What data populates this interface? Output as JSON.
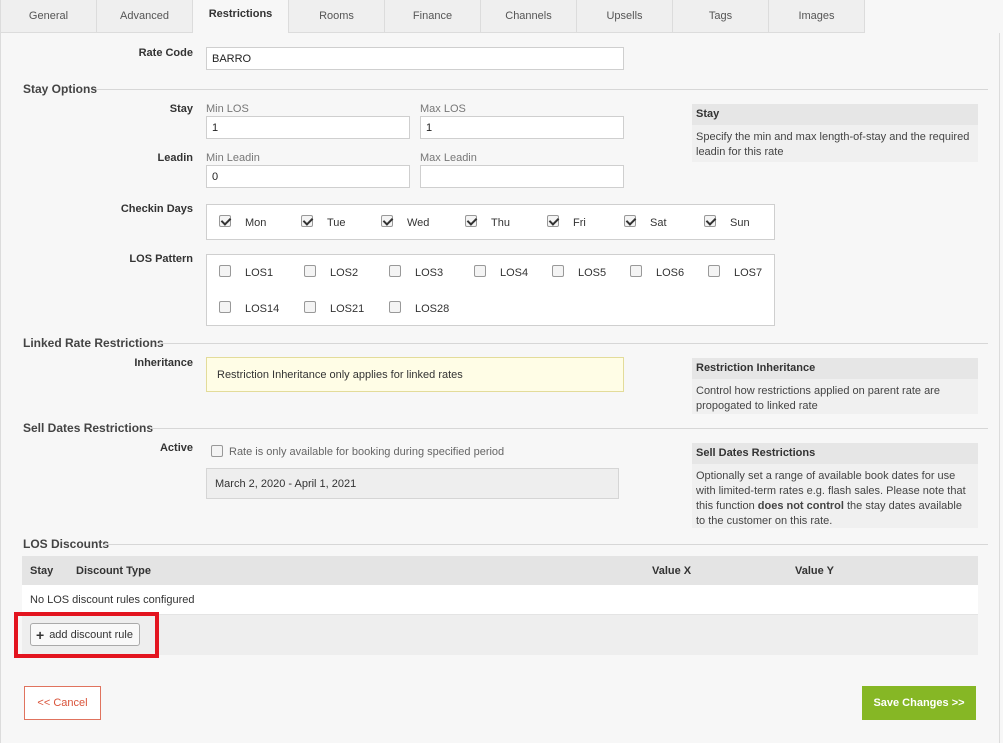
{
  "tabs": [
    {
      "label": "General"
    },
    {
      "label": "Advanced"
    },
    {
      "label": "Restrictions"
    },
    {
      "label": "Rooms"
    },
    {
      "label": "Finance"
    },
    {
      "label": "Channels"
    },
    {
      "label": "Upsells"
    },
    {
      "label": "Tags"
    },
    {
      "label": "Images"
    }
  ],
  "active_tab": "Restrictions",
  "rate_code": {
    "label": "Rate Code",
    "value": "BARRO"
  },
  "stay_options": {
    "title": "Stay Options",
    "stay_label": "Stay",
    "min_los_label": "Min LOS",
    "min_los_value": "1",
    "max_los_label": "Max LOS",
    "max_los_value": "1",
    "leadin_label": "Leadin",
    "min_leadin_label": "Min Leadin",
    "min_leadin_value": "0",
    "max_leadin_label": "Max Leadin",
    "max_leadin_value": "",
    "help_title": "Stay",
    "help_text": "Specify the min and max length-of-stay and the required leadin for this rate"
  },
  "checkin_days": {
    "label": "Checkin Days",
    "days": [
      {
        "label": "Mon",
        "checked": true
      },
      {
        "label": "Tue",
        "checked": true
      },
      {
        "label": "Wed",
        "checked": true
      },
      {
        "label": "Thu",
        "checked": true
      },
      {
        "label": "Fri",
        "checked": true
      },
      {
        "label": "Sat",
        "checked": true
      },
      {
        "label": "Sun",
        "checked": true
      }
    ]
  },
  "los_pattern": {
    "label": "LOS Pattern",
    "items": [
      {
        "label": "LOS1",
        "checked": false
      },
      {
        "label": "LOS2",
        "checked": false
      },
      {
        "label": "LOS3",
        "checked": false
      },
      {
        "label": "LOS4",
        "checked": false
      },
      {
        "label": "LOS5",
        "checked": false
      },
      {
        "label": "LOS6",
        "checked": false
      },
      {
        "label": "LOS7",
        "checked": false
      },
      {
        "label": "LOS14",
        "checked": false
      },
      {
        "label": "LOS21",
        "checked": false
      },
      {
        "label": "LOS28",
        "checked": false
      }
    ]
  },
  "linked_rate": {
    "title": "Linked Rate Restrictions",
    "inheritance_label": "Inheritance",
    "notice": "Restriction Inheritance only applies for linked rates",
    "help_title": "Restriction Inheritance",
    "help_text": "Control how restrictions applied on parent rate are propogated to linked rate"
  },
  "sell_dates": {
    "title": "Sell Dates Restrictions",
    "active_label": "Active",
    "checkbox_label": "Rate is only available for booking during specified period",
    "checked": false,
    "date_range": "March 2, 2020 - April 1, 2021",
    "help_title": "Sell Dates Restrictions",
    "help_text_1": "Optionally set a range of available book dates for use with limited-term rates e.g. flash sales. Please note that this function ",
    "help_text_bold": "does not control",
    "help_text_2": " the stay dates available to the customer on this rate."
  },
  "los_discounts": {
    "title": "LOS Discounts",
    "columns": [
      "Stay",
      "Discount Type",
      "Value X",
      "Value Y"
    ],
    "empty_message": "No LOS discount rules configured",
    "add_button": "add discount rule"
  },
  "footer": {
    "cancel_label": "<< Cancel",
    "save_label": "Save Changes >>"
  },
  "colors": {
    "save_button": "#86b725",
    "cancel_text": "#d9533a",
    "highlight": "#e3141f",
    "notice_bg": "#fffde6"
  }
}
